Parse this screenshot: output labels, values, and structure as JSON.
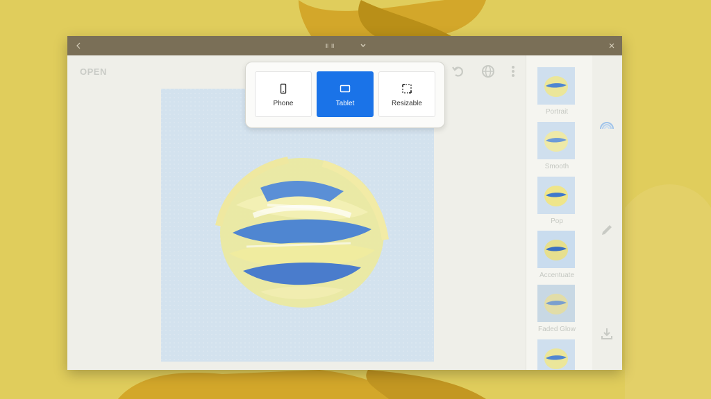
{
  "colors": {
    "wallpaper": "#ddc94f",
    "titlebar": "#7a6f57",
    "accent": "#1a73e8",
    "canvas": "#d3e2ee"
  },
  "titlebar": {
    "back_icon": "back-arrow-icon",
    "resize_icon": "resize-icon",
    "chevron_icon": "chevron-down-icon",
    "close_icon": "close-icon"
  },
  "toolbar": {
    "open_label": "OPEN",
    "icons": [
      "undo-icon",
      "globe-icon",
      "more-vertical-icon"
    ]
  },
  "resize_menu": {
    "selected": "Tablet",
    "options": [
      {
        "label": "Phone",
        "icon": "phone-icon"
      },
      {
        "label": "Tablet",
        "icon": "tablet-icon"
      },
      {
        "label": "Resizable",
        "icon": "resizable-icon"
      }
    ]
  },
  "filters": [
    {
      "label": "Portrait"
    },
    {
      "label": "Smooth"
    },
    {
      "label": "Pop"
    },
    {
      "label": "Accentuate"
    },
    {
      "label": "Faded Glow"
    },
    {
      "label": ""
    }
  ],
  "side_rail": {
    "icons": [
      "rainbow-icon",
      "pencil-icon",
      "download-icon"
    ]
  }
}
